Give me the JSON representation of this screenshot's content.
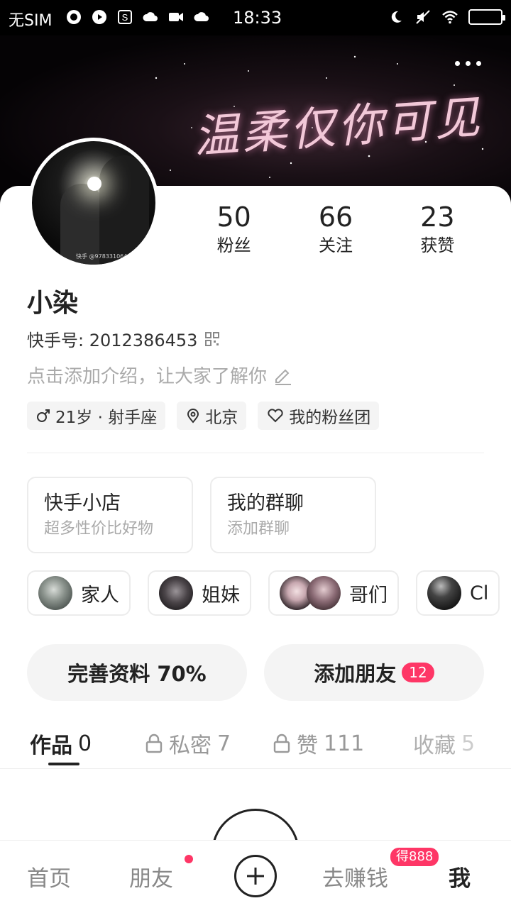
{
  "status_bar": {
    "carrier": "无SIM",
    "time": "18:33"
  },
  "banner": {
    "text": "温柔仅你可见"
  },
  "avatar": {
    "watermark": "快手 @978331064"
  },
  "stats": [
    {
      "value": "50",
      "label": "粉丝"
    },
    {
      "value": "66",
      "label": "关注"
    },
    {
      "value": "23",
      "label": "获赞"
    }
  ],
  "profile": {
    "name": "小染",
    "kuaishou_id": "快手号: 2012386453",
    "intro_placeholder": "点击添加介绍，让大家了解你"
  },
  "tags": {
    "age_zodiac": "21岁 · 射手座",
    "location": "北京",
    "fan_club": "我的粉丝团"
  },
  "boxes": {
    "shop": {
      "title": "快手小店",
      "subtitle": "超多性价比好物"
    },
    "group_chat": {
      "title": "我的群聊",
      "subtitle": "添加群聊"
    }
  },
  "groups": [
    "家人",
    "姐妹",
    "哥们",
    "Cl"
  ],
  "actions": {
    "complete_profile": "完善资料 70%",
    "add_friends": "添加朋友",
    "add_friends_badge": "12"
  },
  "tabs": [
    {
      "label": "作品",
      "count": "0"
    },
    {
      "label": "私密",
      "count": "7"
    },
    {
      "label": "赞",
      "count": "111"
    },
    {
      "label": "收藏",
      "count": "5"
    }
  ],
  "bottom_nav": {
    "home": "首页",
    "friends": "朋友",
    "earn": "去赚钱",
    "earn_badge": "得888",
    "me": "我"
  },
  "colors": {
    "accent": "#fe3666",
    "text": "#222222",
    "muted": "#aaaaaa"
  }
}
